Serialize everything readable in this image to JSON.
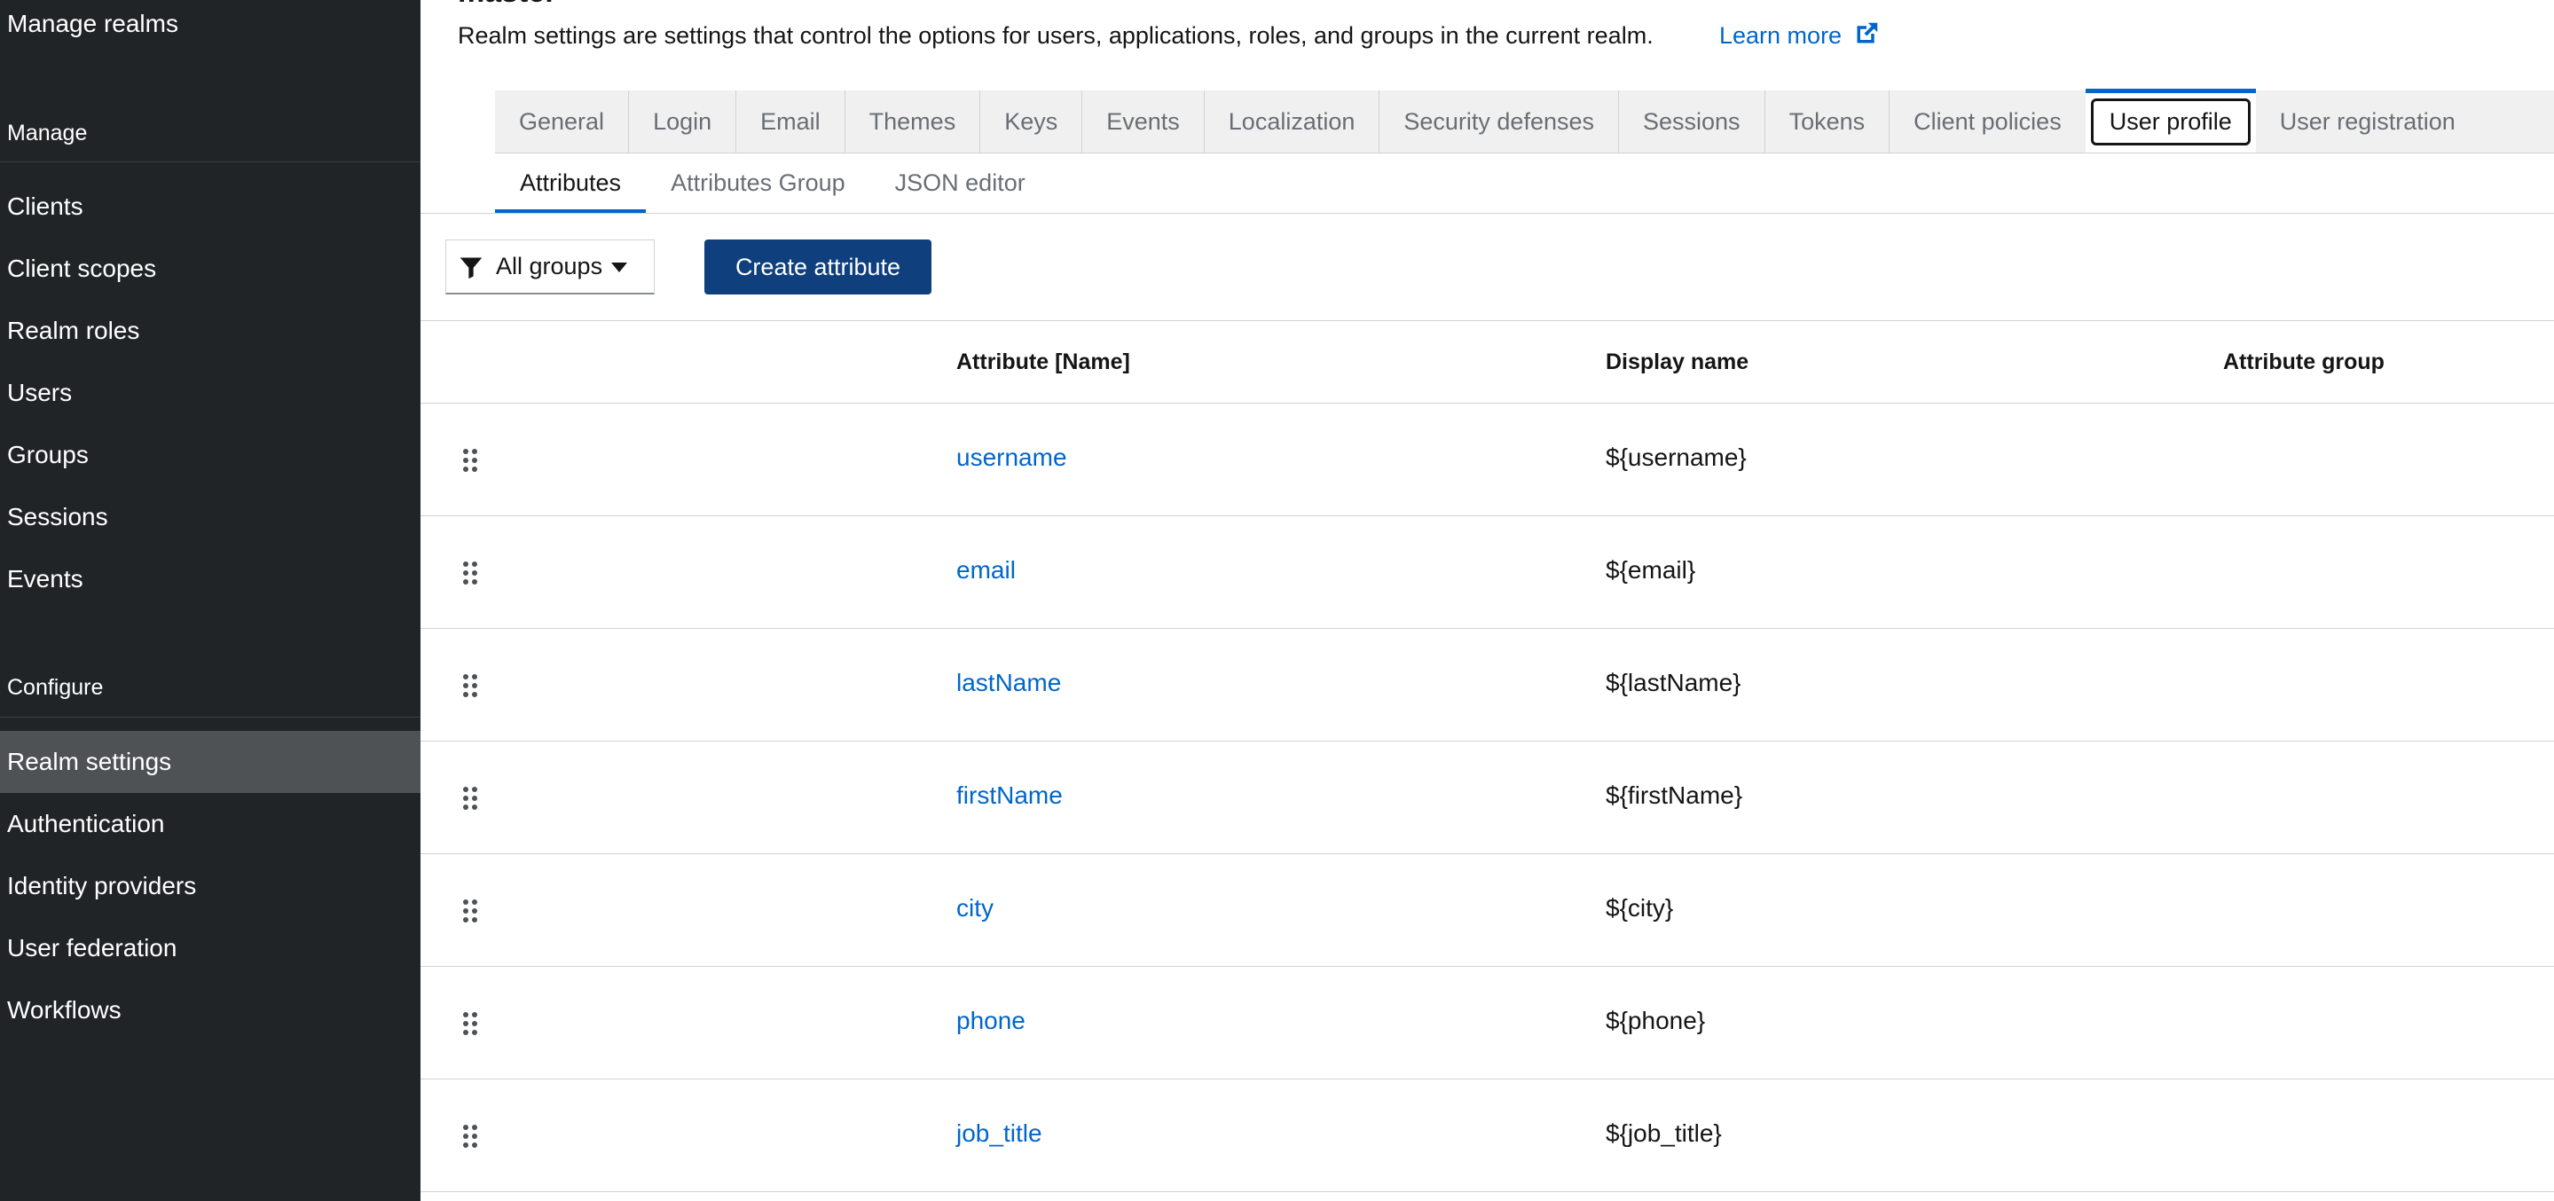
{
  "sidebar": {
    "manage_realms": "Manage realms",
    "manage_heading": "Manage",
    "manage_items": [
      "Clients",
      "Client scopes",
      "Realm roles",
      "Users",
      "Groups",
      "Sessions",
      "Events"
    ],
    "configure_heading": "Configure",
    "configure_items": [
      "Realm settings",
      "Authentication",
      "Identity providers",
      "User federation",
      "Workflows"
    ],
    "active_item": "Realm settings"
  },
  "header": {
    "title": "master",
    "description": "Realm settings are settings that control the options for users, applications, roles, and groups in the current realm.",
    "learn_more": "Learn more"
  },
  "tabs": [
    "General",
    "Login",
    "Email",
    "Themes",
    "Keys",
    "Events",
    "Localization",
    "Security defenses",
    "Sessions",
    "Tokens",
    "Client policies",
    "User profile",
    "User registration"
  ],
  "active_tab": "User profile",
  "subtabs": [
    "Attributes",
    "Attributes Group",
    "JSON editor"
  ],
  "active_subtab": "Attributes",
  "toolbar": {
    "filter_label": "All groups",
    "create_button": "Create attribute"
  },
  "table": {
    "columns": [
      "Attribute [Name]",
      "Display name",
      "Attribute group"
    ],
    "rows": [
      {
        "name": "username",
        "display": "${username}",
        "group": ""
      },
      {
        "name": "email",
        "display": "${email}",
        "group": ""
      },
      {
        "name": "lastName",
        "display": "${lastName}",
        "group": ""
      },
      {
        "name": "firstName",
        "display": "${firstName}",
        "group": ""
      },
      {
        "name": "city",
        "display": "${city}",
        "group": ""
      },
      {
        "name": "phone",
        "display": "${phone}",
        "group": ""
      },
      {
        "name": "job_title",
        "display": "${job_title}",
        "group": ""
      }
    ]
  },
  "colors": {
    "sidebar_bg": "#212427",
    "sidebar_active": "#4f5255",
    "link": "#0066cc",
    "primary_button": "#0f3f7d"
  },
  "icons": {
    "learn_more": "external-link-icon",
    "filter": "filter-icon",
    "dropdown": "caret-down-icon",
    "row_handle": "drag-handle-icon"
  }
}
